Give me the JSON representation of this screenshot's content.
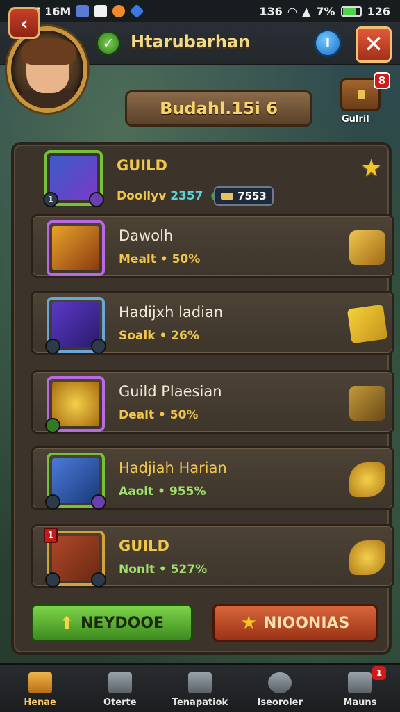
{
  "status_bar": {
    "time_left": "1407 16M",
    "time_right": "136",
    "battery": "7%",
    "clock": "126"
  },
  "header": {
    "player_name": "Htarubarhan",
    "back_glyph": "‹",
    "close_glyph": "✕",
    "info_glyph": "i",
    "shield_glyph": "✓"
  },
  "title_plate": "Budahl.15i 6",
  "chest": {
    "badge": "8",
    "label": "Gulril"
  },
  "rows": [
    {
      "title": "GUILD",
      "stat_label": "Doollyv",
      "stat_value": "2357",
      "badge_value": "7553",
      "icon": "armored-hero-icon",
      "right_icon": "star-icon",
      "level": "1"
    },
    {
      "title": "Dawolh",
      "stat": "Mealt • 50%",
      "icon": "golden-cannon-icon",
      "right_icon": "gauntlet-icon"
    },
    {
      "title": "Hadijxh ladian",
      "stat": "Soalk • 26%",
      "icon": "purple-cannon-icon",
      "right_icon": "gold-cube-icon"
    },
    {
      "title": "Guild Plaesian",
      "stat": "Dealt • 50%",
      "icon": "gold-coil-icon",
      "right_icon": "chest-tool-icon"
    },
    {
      "title": "Hadjiah Harian",
      "stat": "Aaolt • 955%",
      "icon": "knight-hero-icon",
      "right_icon": "gold-swirl-icon"
    },
    {
      "title": "GUILD",
      "stat": "Nonlt • 527%",
      "icon": "treasure-chest-icon",
      "right_icon": "gold-swirl-icon",
      "corner_badge": "1"
    }
  ],
  "buttons": {
    "green_label": "NEYDOOE",
    "red_label": "NIOONIAS"
  },
  "bottom_nav": [
    {
      "label": "Henae",
      "icon": "home-icon",
      "active": true
    },
    {
      "label": "Oterte",
      "icon": "sword-icon"
    },
    {
      "label": "Tenapatiok",
      "icon": "tower-icon"
    },
    {
      "label": "Iseoroler",
      "icon": "clock-icon"
    },
    {
      "label": "Mauns",
      "icon": "menu-icon",
      "badge": "1"
    }
  ],
  "colors": {
    "accent_gold": "#f0c64d",
    "btn_green": "#7ed44a",
    "btn_red": "#d8663a",
    "badge_red": "#d11a1a"
  }
}
